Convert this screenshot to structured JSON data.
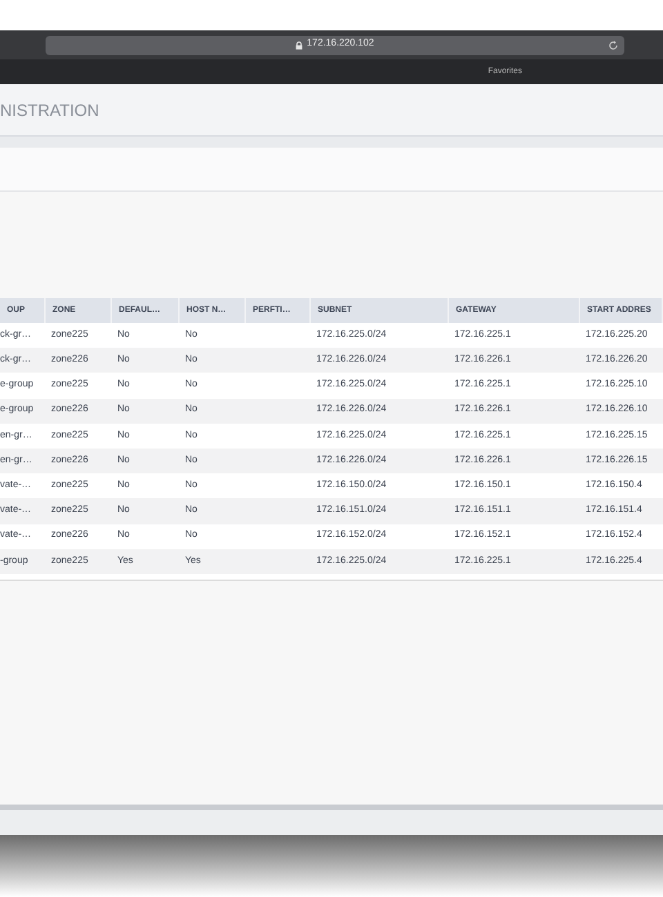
{
  "browser": {
    "address": "172.16.220.102",
    "favorites": "Favorites"
  },
  "page": {
    "title": "NISTRATION"
  },
  "table": {
    "columns": [
      "OUP",
      "ZONE",
      "DEFAUL…",
      "HOST N…",
      "PERFTI…",
      "SUBNET",
      "GATEWAY",
      "START ADDRES"
    ],
    "rows": [
      [
        "ck-gr…",
        "zone225",
        "No",
        "No",
        "",
        "172.16.225.0/24",
        "172.16.225.1",
        "172.16.225.20"
      ],
      [
        "ck-gr…",
        "zone226",
        "No",
        "No",
        "",
        "172.16.226.0/24",
        "172.16.226.1",
        "172.16.226.20"
      ],
      [
        "e-group",
        "zone225",
        "No",
        "No",
        "",
        "172.16.225.0/24",
        "172.16.225.1",
        "172.16.225.10"
      ],
      [
        "e-group",
        "zone226",
        "No",
        "No",
        "",
        "172.16.226.0/24",
        "172.16.226.1",
        "172.16.226.10"
      ],
      [
        "en-gr…",
        "zone225",
        "No",
        "No",
        "",
        "172.16.225.0/24",
        "172.16.225.1",
        "172.16.225.15"
      ],
      [
        "en-gr…",
        "zone226",
        "No",
        "No",
        "",
        "172.16.226.0/24",
        "172.16.226.1",
        "172.16.226.15"
      ],
      [
        "vate-…",
        "zone225",
        "No",
        "No",
        "",
        "172.16.150.0/24",
        "172.16.150.1",
        "172.16.150.4"
      ],
      [
        "vate-…",
        "zone225",
        "No",
        "No",
        "",
        "172.16.151.0/24",
        "172.16.151.1",
        "172.16.151.4"
      ],
      [
        "vate-…",
        "zone226",
        "No",
        "No",
        "",
        "172.16.152.0/24",
        "172.16.152.1",
        "172.16.152.4"
      ],
      [
        "-group",
        "zone225",
        "Yes",
        "Yes",
        "",
        "172.16.225.0/24",
        "172.16.225.1",
        "172.16.225.4"
      ]
    ]
  }
}
